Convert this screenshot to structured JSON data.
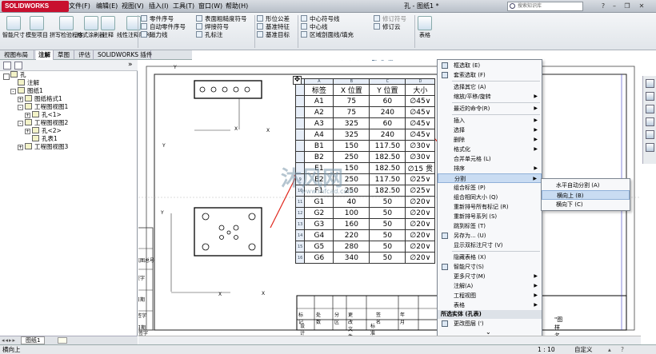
{
  "app": {
    "logo": "SOLIDWORKS",
    "doc_title": "孔 - 图纸1 *",
    "search_placeholder": "搜索知识库"
  },
  "menubar": [
    "文件(F)",
    "编辑(E)",
    "视图(V)",
    "插入(I)",
    "工具(T)",
    "窗口(W)",
    "帮助(H)"
  ],
  "ribbon": {
    "big": [
      {
        "label": "智能尺寸",
        "icon": "smart-dimension-icon"
      },
      {
        "label": "模型项目",
        "icon": "model-items-icon"
      },
      {
        "label": "拼写检验程序",
        "icon": "spell-check-icon"
      },
      {
        "label": "格式涂刷器",
        "icon": "format-painter-icon"
      },
      {
        "label": "注释",
        "icon": "note-icon"
      },
      {
        "label": "线性注释阵列",
        "icon": "linear-pattern-icon"
      },
      {
        "label": "表格",
        "icon": "table-icon"
      }
    ],
    "col1": [
      "零件序号",
      "自动零件序号",
      "磁力线"
    ],
    "col2": [
      "表面粗糙度符号",
      "焊接符号",
      "孔标注"
    ],
    "col3": [
      "形位公差",
      "基准特征",
      "基准目标"
    ],
    "col4": [
      "中心符号线",
      "中心线",
      "区域剖面线/填充"
    ],
    "col5": [
      "修订符号",
      "修订云"
    ]
  },
  "tabs": [
    "视图布局",
    "注解",
    "草图",
    "评估",
    "SOLIDWORKS 插件"
  ],
  "active_tab": "注解",
  "tree": [
    {
      "label": "孔",
      "level": 0,
      "exp": ""
    },
    {
      "label": "注解",
      "level": 1,
      "exp": ""
    },
    {
      "label": "图纸1",
      "level": 1,
      "exp": "-"
    },
    {
      "label": "图纸格式1",
      "level": 2,
      "exp": "+"
    },
    {
      "label": "工程图视图1",
      "level": 2,
      "exp": "-"
    },
    {
      "label": "孔<1>",
      "level": 3,
      "exp": "+"
    },
    {
      "label": "工程图视图2",
      "level": 2,
      "exp": "-"
    },
    {
      "label": "孔<2>",
      "level": 3,
      "exp": "+"
    },
    {
      "label": "孔表1",
      "level": 3,
      "exp": ""
    },
    {
      "label": "工程图视图3",
      "level": 2,
      "exp": "+"
    }
  ],
  "hole_table": {
    "col_letters": [
      "A",
      "B",
      "C",
      "D"
    ],
    "headers": [
      "标签",
      "X 位置",
      "Y 位置",
      "大小"
    ],
    "rows": [
      [
        "A1",
        "75",
        "60",
        "∅45∨"
      ],
      [
        "A2",
        "75",
        "240",
        "∅45∨"
      ],
      [
        "A3",
        "325",
        "60",
        "∅45∨"
      ],
      [
        "A4",
        "325",
        "240",
        "∅45∨"
      ],
      [
        "B1",
        "150",
        "117.50",
        "∅30∨"
      ],
      [
        "B2",
        "250",
        "182.50",
        "∅30∨"
      ],
      [
        "E1",
        "150",
        "182.50",
        "∅15 贯"
      ],
      [
        "E2",
        "250",
        "117.50",
        "∅25∨"
      ],
      [
        "F1",
        "250",
        "182.50",
        "∅25∨"
      ],
      [
        "G1",
        "40",
        "50",
        "∅20∨"
      ],
      [
        "G2",
        "100",
        "50",
        "∅20∨"
      ],
      [
        "G3",
        "160",
        "50",
        "∅20∨"
      ],
      [
        "G4",
        "220",
        "50",
        "∅20∨"
      ],
      [
        "G5",
        "280",
        "50",
        "∅20∨"
      ],
      [
        "G6",
        "340",
        "50",
        "∅20∨"
      ]
    ],
    "row_letters": [
      "",
      "",
      "",
      "",
      "",
      "",
      "",
      "",
      "9",
      "10",
      "11",
      "12",
      "13",
      "14",
      "15",
      "16"
    ]
  },
  "title_block": {
    "row1": [
      "标记",
      "处数",
      "分区",
      "更改文件号",
      "签名",
      "年 月"
    ],
    "row2": [
      "设计",
      "",
      "",
      "标准化"
    ],
    "drawing_name": "\"图样名称\""
  },
  "border_labels": [
    "Y",
    "Y",
    "X",
    "X",
    "Y",
    "X",
    "X",
    "底图总号",
    "签字",
    "日期",
    "签字",
    "日期",
    "签字"
  ],
  "context_menu": [
    {
      "label": "框选取 (E)",
      "arrow": false,
      "icon": "box-select-icon"
    },
    {
      "label": "套索选取 (F)",
      "arrow": false,
      "icon": "lasso-icon"
    },
    {
      "sep": true
    },
    {
      "label": "选择其它 (A)",
      "arrow": false
    },
    {
      "label": "缩放/平移/旋转",
      "arrow": true
    },
    {
      "sep": true
    },
    {
      "label": "最近的命令(R)",
      "arrow": true
    },
    {
      "sep": true
    },
    {
      "label": "插入",
      "arrow": true
    },
    {
      "label": "选择",
      "arrow": true
    },
    {
      "label": "删除",
      "arrow": true
    },
    {
      "label": "格式化",
      "arrow": true
    },
    {
      "label": "合并单元格 (L)",
      "arrow": false
    },
    {
      "label": "排序",
      "arrow": true
    },
    {
      "label": "分割",
      "arrow": true,
      "hl": true
    },
    {
      "label": "组合标签 (P)",
      "arrow": false
    },
    {
      "label": "组合相同大小 (Q)",
      "arrow": false
    },
    {
      "label": "重新排号所有标记 (R)",
      "arrow": false
    },
    {
      "label": "重新排号系列 (S)",
      "arrow": false
    },
    {
      "label": "跳到标签 (T)",
      "arrow": false
    },
    {
      "label": "另存为... (U)",
      "arrow": false,
      "icon": "save-icon"
    },
    {
      "label": "显示双标注尺寸 (V)",
      "arrow": false
    },
    {
      "sep": true
    },
    {
      "label": "隐藏表格 (X)",
      "arrow": false
    },
    {
      "label": "智能尺寸(S)",
      "arrow": false,
      "icon": "smart-dim-icon"
    },
    {
      "label": "更多尺寸(M)",
      "arrow": true
    },
    {
      "label": "注解(A)",
      "arrow": true
    },
    {
      "label": "工程视图",
      "arrow": true
    },
    {
      "label": "表格",
      "arrow": true
    },
    {
      "section": "所选实体 (孔表)"
    },
    {
      "label": "更改图层 (')",
      "arrow": false,
      "icon": "layer-icon"
    },
    {
      "more": "⌄"
    }
  ],
  "submenu": [
    {
      "label": "水平自动分割 (A)"
    },
    {
      "label": "横向上 (B)",
      "hl": true
    },
    {
      "label": "横向下 (C)"
    }
  ],
  "sheet_tab": "图纸1",
  "status": {
    "left": "横向上",
    "scale": "1 : 10",
    "mode": "自定义"
  },
  "watermark": "沐风网",
  "watermark_url": "www.mfcad.com",
  "colors": {
    "accent": "#c8102e",
    "arrow": "#e0261b",
    "highlight": "#c9dcf2"
  }
}
